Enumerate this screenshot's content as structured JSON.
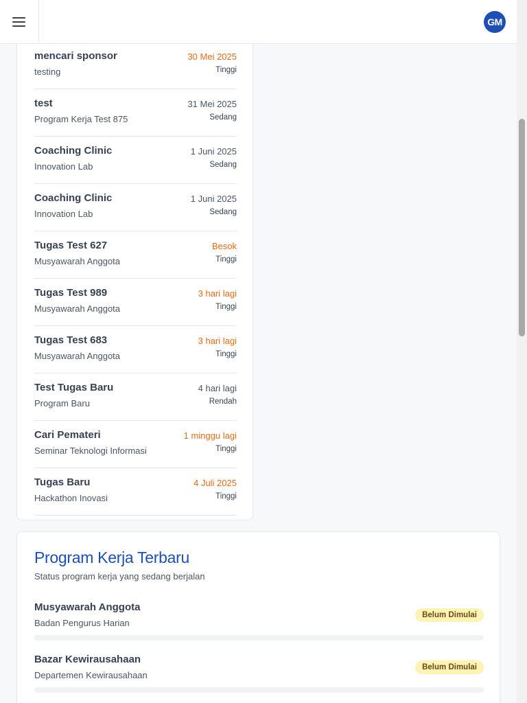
{
  "header": {
    "avatar_initials": "GM",
    "menu_icon": "hamburger-menu-icon"
  },
  "tasks": [
    {
      "title": "mencari sponsor",
      "program": "testing",
      "due": "30 Mei 2025",
      "priority": "Tinggi",
      "due_urgent": true
    },
    {
      "title": "test",
      "program": "Program Kerja Test 875",
      "due": "31 Mei 2025",
      "priority": "Sedang",
      "due_urgent": false
    },
    {
      "title": "Coaching Clinic",
      "program": "Innovation Lab",
      "due": "1 Juni 2025",
      "priority": "Sedang",
      "due_urgent": false
    },
    {
      "title": "Coaching Clinic",
      "program": "Innovation Lab",
      "due": "1 Juni 2025",
      "priority": "Sedang",
      "due_urgent": false
    },
    {
      "title": "Tugas Test 627",
      "program": "Musyawarah Anggota",
      "due": "Besok",
      "priority": "Tinggi",
      "due_urgent": true
    },
    {
      "title": "Tugas Test 989",
      "program": "Musyawarah Anggota",
      "due": "3 hari lagi",
      "priority": "Tinggi",
      "due_urgent": true
    },
    {
      "title": "Tugas Test 683",
      "program": "Musyawarah Anggota",
      "due": "3 hari lagi",
      "priority": "Tinggi",
      "due_urgent": true
    },
    {
      "title": "Test Tugas Baru",
      "program": "Program Baru",
      "due": "4 hari lagi",
      "priority": "Rendah",
      "due_urgent": false
    },
    {
      "title": "Cari Pemateri",
      "program": "Seminar Teknologi Informasi",
      "due": "1 minggu lagi",
      "priority": "Tinggi",
      "due_urgent": true
    },
    {
      "title": "Tugas Baru",
      "program": "Hackathon Inovasi",
      "due": "4 Juli 2025",
      "priority": "Tinggi",
      "due_urgent": true
    }
  ],
  "programs_section": {
    "title": "Program Kerja Terbaru",
    "description": "Status program kerja yang sedang berjalan",
    "items": [
      {
        "name": "Musyawarah Anggota",
        "department": "Badan Pengurus Harian",
        "status": "Belum Dimulai",
        "progress": 0
      },
      {
        "name": "Bazar Kewirausahaan",
        "department": "Departemen Kewirausahaan",
        "status": "Belum Dimulai",
        "progress": 0
      }
    ]
  },
  "colors": {
    "brand": "#1e4fb5",
    "urgent_due": "#ea6a12",
    "status_not_started_bg": "#fdf3b4"
  }
}
